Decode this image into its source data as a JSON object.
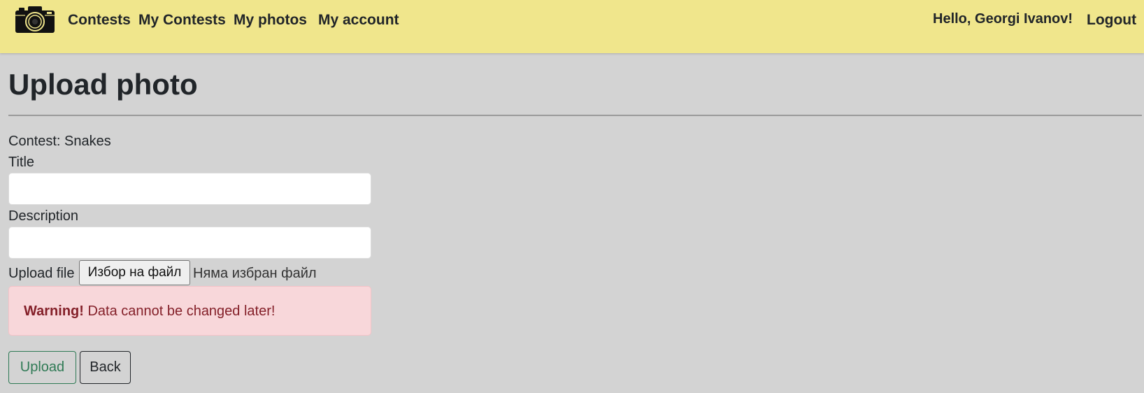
{
  "navbar": {
    "logo_icon": "camera-icon",
    "links": [
      {
        "label": "Contests"
      },
      {
        "label": "My Contests"
      },
      {
        "label": "My photos"
      },
      {
        "label": "My account"
      }
    ],
    "greeting": "Hello, Georgi Ivanov!",
    "logout_label": "Logout",
    "background": "#f0e68c"
  },
  "page": {
    "title": "Upload photo",
    "background": "#d3d3d3"
  },
  "form": {
    "contest_text": "Contest: Snakes",
    "title_label": "Title",
    "title_value": "",
    "description_label": "Description",
    "description_value": "",
    "upload_label": "Upload file",
    "file_button_label": "Избор на файл",
    "file_status": "Няма избран файл"
  },
  "alert": {
    "strong": "Warning!",
    "message": " Data cannot be changed later!",
    "background": "#f8d7da",
    "text_color": "#842029"
  },
  "actions": {
    "upload_label": "Upload",
    "back_label": "Back",
    "upload_color": "#2f7a55"
  }
}
